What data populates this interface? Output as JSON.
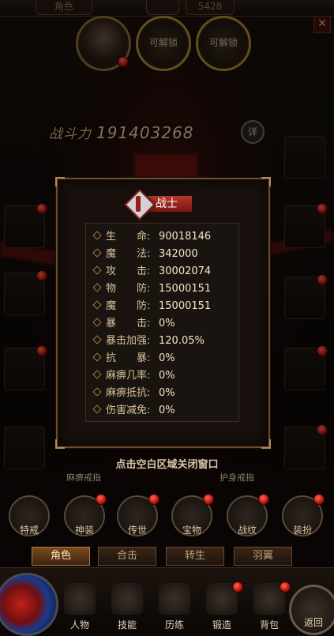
{
  "top": {
    "tabs": [
      "角色",
      "",
      "",
      "5428"
    ],
    "close_icon": "close-icon"
  },
  "portraits": {
    "locked_label": "可解锁"
  },
  "power": {
    "label": "战斗力",
    "value": "191403268",
    "detail_label": "详"
  },
  "panel": {
    "class_name": "战士",
    "stats": [
      {
        "label": "生　　命:",
        "value": "90018146"
      },
      {
        "label": "魔　　法:",
        "value": "342000"
      },
      {
        "label": "攻　　击:",
        "value": "30002074"
      },
      {
        "label": "物　　防:",
        "value": "15000151"
      },
      {
        "label": "魔　　防:",
        "value": "15000151"
      },
      {
        "label": "暴　　击:",
        "value": "0%"
      },
      {
        "label": "暴击加强:",
        "value": "120.05%"
      },
      {
        "label": "抗　　暴:",
        "value": "0%"
      },
      {
        "label": "麻痹几率:",
        "value": "0%"
      },
      {
        "label": "麻痹抵抗:",
        "value": "0%"
      },
      {
        "label": "伤害减免:",
        "value": "0%"
      }
    ]
  },
  "hint": "点击空白区域关闭窗口",
  "ring_labels": [
    "麻痹戒指",
    "护身戒指"
  ],
  "features": [
    "特戒",
    "神装",
    "传世",
    "宝物",
    "战纹",
    "装扮"
  ],
  "tabs": [
    "角色",
    "合击",
    "转生",
    "羽翼"
  ],
  "bottom_menu": [
    "人物",
    "技能",
    "历练",
    "锻造",
    "背包"
  ],
  "back_label": "返回"
}
